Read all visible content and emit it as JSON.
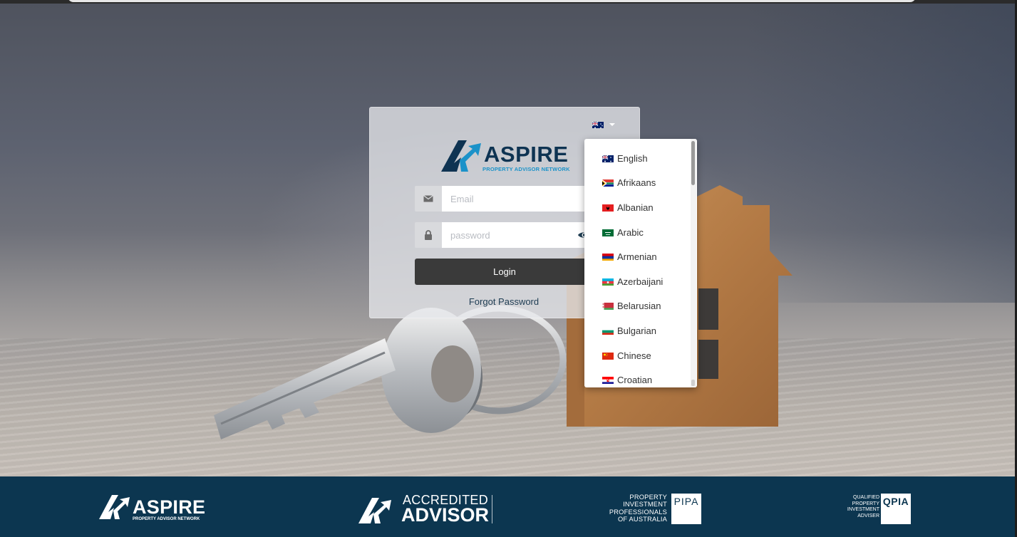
{
  "login": {
    "current_language_flag": "flag-au-icon",
    "brand": {
      "name": "ASPIRE",
      "tagline": "PROPERTY ADVISOR NETWORK"
    },
    "email": {
      "placeholder": "Email",
      "icon": "envelope-icon"
    },
    "password": {
      "placeholder": "password",
      "icon": "lock-icon",
      "toggle_icon": "eye-icon"
    },
    "login_label": "Login",
    "forgot_label": "Forgot Password"
  },
  "language_menu": {
    "items": [
      {
        "label": "English",
        "flag": "au"
      },
      {
        "label": "Afrikaans",
        "flag": "za"
      },
      {
        "label": "Albanian",
        "flag": "al"
      },
      {
        "label": "Arabic",
        "flag": "sa"
      },
      {
        "label": "Armenian",
        "flag": "am"
      },
      {
        "label": "Azerbaijani",
        "flag": "az"
      },
      {
        "label": "Belarusian",
        "flag": "by"
      },
      {
        "label": "Bulgarian",
        "flag": "bg"
      },
      {
        "label": "Chinese",
        "flag": "cn"
      },
      {
        "label": "Croatian",
        "flag": "hr"
      }
    ]
  },
  "footer": {
    "aspire": {
      "name": "ASPIRE",
      "tagline": "PROPERTY ADVISOR NETWORK"
    },
    "accredited": {
      "line1": "ACCREDITED",
      "line2": "ADVISOR"
    },
    "pipa": {
      "text_lines": [
        "PROPERTY",
        "INVESTMENT",
        "PROFESSIONALS",
        "OF AUSTRALIA"
      ],
      "badge": "PIPA"
    },
    "qpia": {
      "text_lines": [
        "QUALIFIED",
        "PROPERTY",
        "INVESTMENT",
        "ADVISER"
      ],
      "badge": "QPIA"
    }
  },
  "colors": {
    "footer_bg": "#0c3650",
    "brand_navy": "#0e3352",
    "brand_blue": "#1b92c9",
    "login_button": "#3a3a3a"
  }
}
